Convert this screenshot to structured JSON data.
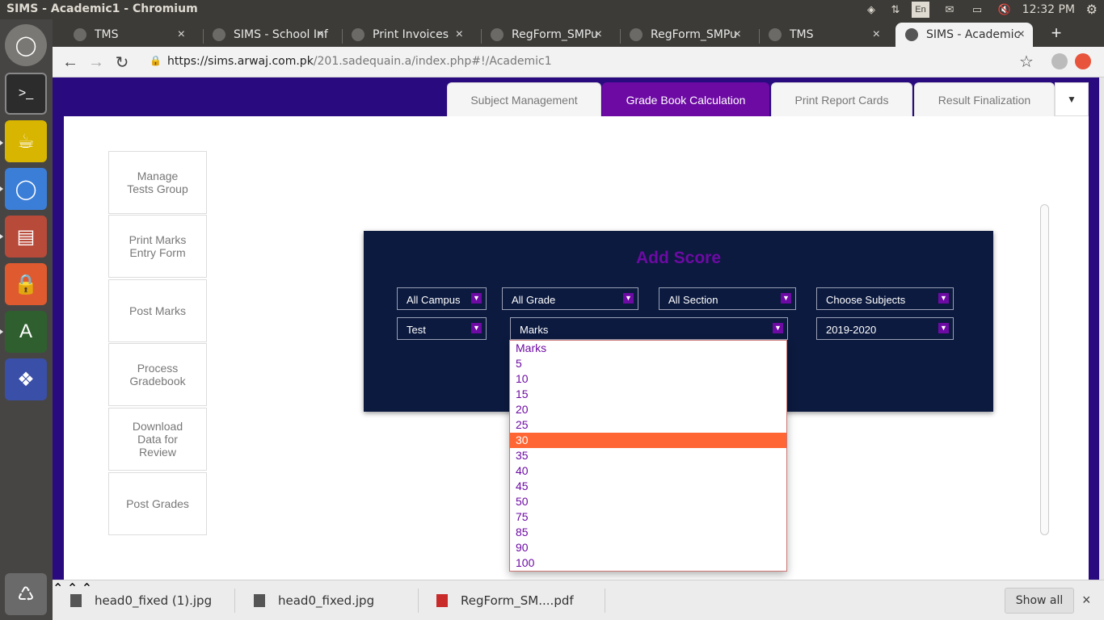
{
  "os": {
    "window_title": "SIMS - Academic1 - Chromium",
    "clock": "12:32 PM",
    "keyboard_layout": "En"
  },
  "browser": {
    "tabs": [
      {
        "label": "TMS",
        "active": false
      },
      {
        "label": "SIMS - School Inf",
        "active": false
      },
      {
        "label": "Print Invoices",
        "active": false
      },
      {
        "label": "RegForm_SMPu",
        "active": false
      },
      {
        "label": "RegForm_SMPu",
        "active": false
      },
      {
        "label": "TMS",
        "active": false
      },
      {
        "label": "SIMS - Academic",
        "active": true
      }
    ],
    "url_host": "https://sims.arwaj.com.pk",
    "url_path": "/201.sadequain.a/index.php#!/Academic1"
  },
  "app": {
    "top_tabs": [
      {
        "label": "Subject Management",
        "active": false
      },
      {
        "label": "Grade Book Calculation",
        "active": true
      },
      {
        "label": "Print Report Cards",
        "active": false
      },
      {
        "label": "Result Finalization",
        "active": false
      }
    ],
    "side_menu": [
      {
        "label": "Manage Tests Group"
      },
      {
        "label": "Print Marks Entry Form"
      },
      {
        "label": "Post Marks"
      },
      {
        "label": "Process Gradebook"
      },
      {
        "label": "Download Data for Review"
      },
      {
        "label": "Post Grades"
      }
    ],
    "add_score": {
      "title": "Add Score",
      "campus": "All Campus",
      "grade": "All Grade",
      "section": "All Section",
      "subjects": "Choose Subjects",
      "test": "Test",
      "marks": "Marks",
      "session": "2019-2020"
    },
    "marks_options": [
      "Marks",
      "5",
      "10",
      "15",
      "20",
      "25",
      "30",
      "35",
      "40",
      "45",
      "50",
      "75",
      "85",
      "90",
      "100"
    ],
    "marks_highlighted": "30"
  },
  "downloads": {
    "items": [
      {
        "name": "head0_fixed (1).jpg"
      },
      {
        "name": "head0_fixed.jpg"
      },
      {
        "name": "RegForm_SM....pdf"
      }
    ],
    "show_all": "Show all"
  },
  "colors": {
    "accent_purple": "#6d0aa4",
    "page_background": "#2a0a7f",
    "panel_navy": "#0c1a3f",
    "highlight_orange": "#ff6633"
  }
}
